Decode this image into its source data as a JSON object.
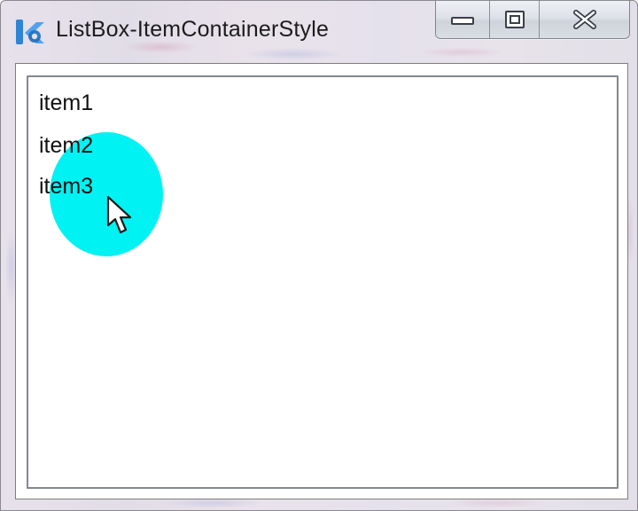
{
  "window": {
    "title": "ListBox-ItemContainerStyle",
    "icon": "kotlin-k-logo-icon",
    "caption_buttons": [
      "minimize-icon",
      "maximize-icon",
      "close-icon"
    ]
  },
  "listbox": {
    "items": [
      {
        "label": "item1"
      },
      {
        "label": "item2"
      },
      {
        "label": "item3"
      }
    ],
    "hover_highlight_color": "#00f2f2"
  },
  "colors": {
    "accent_kotlin_blue": "#2e7fd0",
    "frame_tint": "#e5e1ea"
  }
}
